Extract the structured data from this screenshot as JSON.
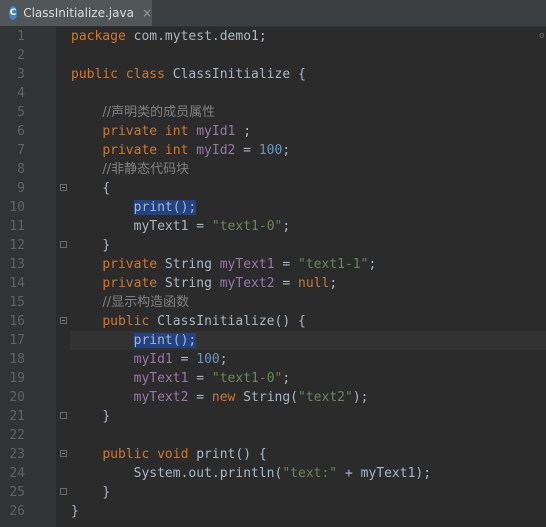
{
  "tab": {
    "icon_letter": "C",
    "title": "ClassInitialize.java",
    "close": "×"
  },
  "gutter": {
    "line_numbers": [
      "1",
      "2",
      "3",
      "4",
      "5",
      "6",
      "7",
      "8",
      "9",
      "10",
      "11",
      "12",
      "13",
      "14",
      "15",
      "16",
      "17",
      "18",
      "19",
      "20",
      "21",
      "22",
      "23",
      "24",
      "25",
      "26"
    ]
  },
  "scroll_marker": "o",
  "code": {
    "l1": {
      "kw": "package",
      "rest": " com.mytest.demo1;"
    },
    "l3": {
      "kw": "public class",
      "rest": " ClassInitialize {"
    },
    "l5": {
      "comment": "//声明类的成员属性"
    },
    "l6": {
      "kw": "private int",
      "field": "myId1",
      "rest": " ;"
    },
    "l7": {
      "kw": "private int",
      "field": "myId2",
      "eq": " = ",
      "num": "100",
      "end": ";"
    },
    "l8": {
      "comment": "//非静态代码块"
    },
    "l9": {
      "text": "{"
    },
    "l10": {
      "call": "print();"
    },
    "l11": {
      "text": "myText1 = ",
      "str": "\"text1-0\"",
      "end": ";"
    },
    "l12": {
      "text": "}"
    },
    "l13": {
      "kw": "private",
      "type": " String ",
      "field": "myText1",
      "eq": " = ",
      "str": "\"text1-1\"",
      "end": ";"
    },
    "l14": {
      "kw": "private",
      "type": " String ",
      "field": "myText2",
      "eq": " = ",
      "kw2": "null",
      "end": ";"
    },
    "l15": {
      "comment": "//显示构造函数"
    },
    "l16": {
      "kw": "public",
      "rest": " ClassInitialize() {"
    },
    "l17": {
      "call": "print();"
    },
    "l18": {
      "field": "myId1",
      "eq": " = ",
      "num": "100",
      "end": ";"
    },
    "l19": {
      "field": "myText1",
      "eq": " = ",
      "str": "\"text1-0\"",
      "end": ";"
    },
    "l20": {
      "field": "myText2",
      "eq": " = ",
      "kw": "new",
      "rest": " String(",
      "str": "\"text2\"",
      "end": ");"
    },
    "l21": {
      "text": "}"
    },
    "l23": {
      "kw": "public void",
      "rest": " print() {"
    },
    "l24": {
      "text": "System.out.println(",
      "str": "\"text:\"",
      "mid": " + ",
      "field": "myText1",
      "end": ");"
    },
    "l25": {
      "text": "}"
    },
    "l26": {
      "text": "}"
    }
  },
  "colors": {
    "background": "#2b2b2b",
    "keyword": "#cc7832",
    "string": "#6a8759",
    "number": "#6897bb",
    "field": "#9876aa",
    "comment": "#808080",
    "selection": "#214283"
  }
}
